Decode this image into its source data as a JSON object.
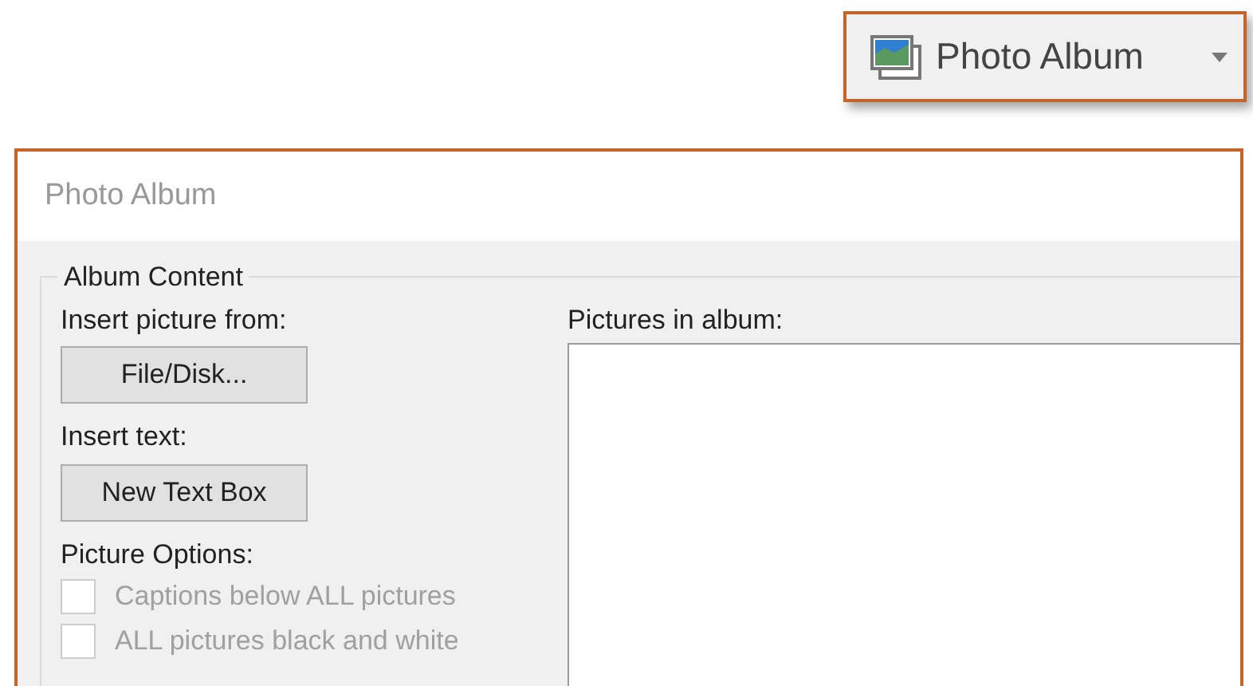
{
  "ribbon_button": {
    "label": "Photo Album"
  },
  "dialog": {
    "title": "Photo Album",
    "group": {
      "legend": "Album Content",
      "insert_picture": {
        "label": "Insert picture from:",
        "button": {
          "label": "File/Disk..."
        }
      },
      "insert_text": {
        "label": "Insert text:",
        "button": {
          "label": "New Text Box"
        }
      },
      "picture_options": {
        "label": "Picture Options:",
        "options": [
          {
            "label": "Captions below ALL pictures",
            "checked": false,
            "disabled": true
          },
          {
            "label": "ALL pictures black and white",
            "checked": false,
            "disabled": true
          }
        ]
      },
      "pictures_in_album": {
        "label": "Pictures in album:"
      }
    }
  }
}
